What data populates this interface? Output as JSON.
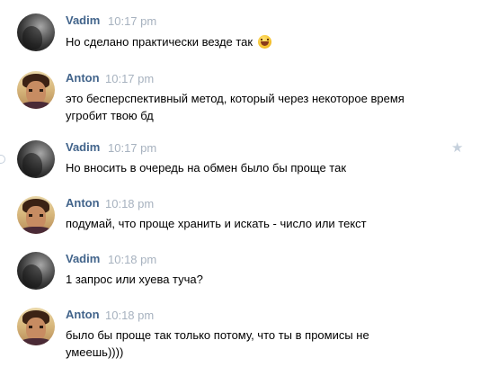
{
  "messages": [
    {
      "author": "Vadim",
      "time": "10:17 pm",
      "text": "Но сделано практически везде так",
      "emoji": "grinning-squinting-face"
    },
    {
      "author": "Anton",
      "time": "10:17 pm",
      "lines": [
        "это бесперспективный метод, который через некоторое время",
        "угробит твою бд"
      ]
    },
    {
      "author": "Vadim",
      "time": "10:17 pm",
      "text": "Но вносить в очередь на обмен было бы проще так"
    },
    {
      "author": "Anton",
      "time": "10:18 pm",
      "text": "подумай, что проще хранить и искать - число или текст"
    },
    {
      "author": "Vadim",
      "time": "10:18 pm",
      "text": "1 запрос или хуева туча?"
    },
    {
      "author": "Anton",
      "time": "10:18 pm",
      "lines": [
        "было бы проще так только потому, что ты в промисы не",
        "умеешь))))"
      ]
    }
  ],
  "icons": {
    "star": "star-icon"
  },
  "colors": {
    "author_name": "#42648b",
    "timestamp": "#a7b2bf",
    "message_text": "#000000",
    "star": "#c5d0dc"
  }
}
